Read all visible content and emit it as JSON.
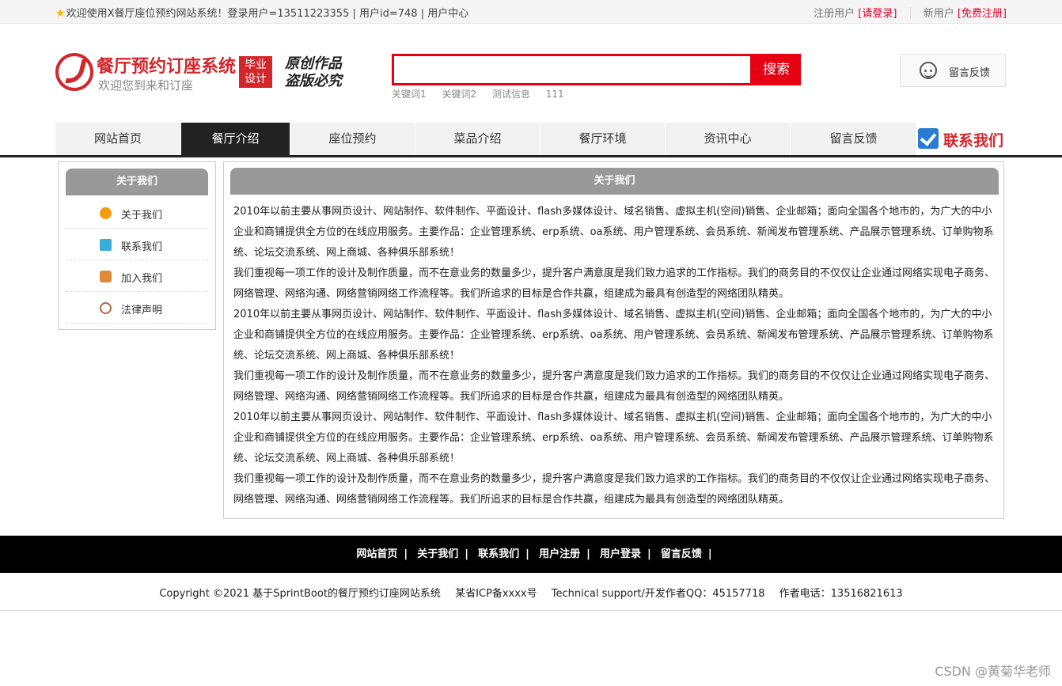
{
  "topbar": {
    "welcome": "欢迎使用X餐厅座位预约网站系统！登录用户=13511223355 | 用户id=748 | ",
    "user_center": "用户中心",
    "registered_label": "注册用户",
    "login_link": "[请登录]",
    "new_user_label": "新用户",
    "register_link": "[免费注册]"
  },
  "header": {
    "title": "餐厅预约订座系统",
    "subtitle": "欢迎您到来和订座",
    "badge_line1": "毕业",
    "badge_line2": "设计",
    "calli_line1": "原创作品",
    "calli_line2": "盗版必究",
    "search_placeholder": "",
    "search_button": "搜索",
    "hotwords": [
      "关键词1",
      "关键词2",
      "测试信息",
      "111"
    ],
    "feedback": "留言反馈"
  },
  "nav": {
    "items": [
      "网站首页",
      "餐厅介绍",
      "座位预约",
      "菜品介绍",
      "餐厅环境",
      "资讯中心",
      "留言反馈"
    ],
    "active_index": 1,
    "contact": "联系我们"
  },
  "sidebar": {
    "title": "关于我们",
    "items": [
      {
        "label": "关于我们",
        "icon": "circle-arrow-icon"
      },
      {
        "label": "联系我们",
        "icon": "clipboard-icon"
      },
      {
        "label": "加入我们",
        "icon": "lock-icon"
      },
      {
        "label": "法律声明",
        "icon": "power-icon"
      }
    ]
  },
  "main": {
    "title": "关于我们",
    "paragraphs": [
      "2010年以前主要从事网页设计、网站制作、软件制作、平面设计、flash多媒体设计、域名销售、虚拟主机(空间)销售、企业邮箱；面向全国各个地市的，为广大的中小企业和商铺提供全方位的在线应用服务。主要作品：企业管理系统、erp系统、oa系统、用户管理系统、会员系统、新闻发布管理系统、产品展示管理系统、订单购物系统、论坛交流系统、网上商城、各种俱乐部系统！",
      "我们重视每一项工作的设计及制作质量，而不在意业务的数量多少，提升客户满意度是我们致力追求的工作指标。我们的商务目的不仅仅让企业通过网络实现电子商务、网络管理、网络沟通、网络营销网络工作流程等。我们所追求的目标是合作共赢，组建成为最具有创造型的网络团队精英。",
      "2010年以前主要从事网页设计、网站制作、软件制作、平面设计、flash多媒体设计、域名销售、虚拟主机(空间)销售、企业邮箱；面向全国各个地市的，为广大的中小企业和商铺提供全方位的在线应用服务。主要作品：企业管理系统、erp系统、oa系统、用户管理系统、会员系统、新闻发布管理系统、产品展示管理系统、订单购物系统、论坛交流系统、网上商城、各种俱乐部系统！",
      "我们重视每一项工作的设计及制作质量，而不在意业务的数量多少，提升客户满意度是我们致力追求的工作指标。我们的商务目的不仅仅让企业通过网络实现电子商务、网络管理、网络沟通、网络营销网络工作流程等。我们所追求的目标是合作共赢，组建成为最具有创造型的网络团队精英。",
      "2010年以前主要从事网页设计、网站制作、软件制作、平面设计、flash多媒体设计、域名销售、虚拟主机(空间)销售、企业邮箱；面向全国各个地市的，为广大的中小企业和商铺提供全方位的在线应用服务。主要作品：企业管理系统、erp系统、oa系统、用户管理系统、会员系统、新闻发布管理系统、产品展示管理系统、订单购物系统、论坛交流系统、网上商城、各种俱乐部系统！",
      "我们重视每一项工作的设计及制作质量，而不在意业务的数量多少，提升客户满意度是我们致力追求的工作指标。我们的商务目的不仅仅让企业通过网络实现电子商务、网络管理、网络沟通、网络营销网络工作流程等。我们所追求的目标是合作共赢，组建成为最具有创造型的网络团队精英。"
    ]
  },
  "footer": {
    "links": [
      "网站首页",
      "关于我们",
      "联系我们",
      "用户注册",
      "用户登录",
      "留言反馈"
    ],
    "separator": "|",
    "copyright": "Copyright ©2021 基于SprintBoot的餐厅预约订座网站系统",
    "icp": "某省ICP备xxxx号",
    "support": "Technical support/开发作者QQ：45157718",
    "phone": "作者电话：13516821613"
  },
  "watermark": "CSDN @黄菊华老师",
  "colors": {
    "brand_red": "#e60012",
    "nav_active": "#222222",
    "panel_header": "#999999"
  }
}
